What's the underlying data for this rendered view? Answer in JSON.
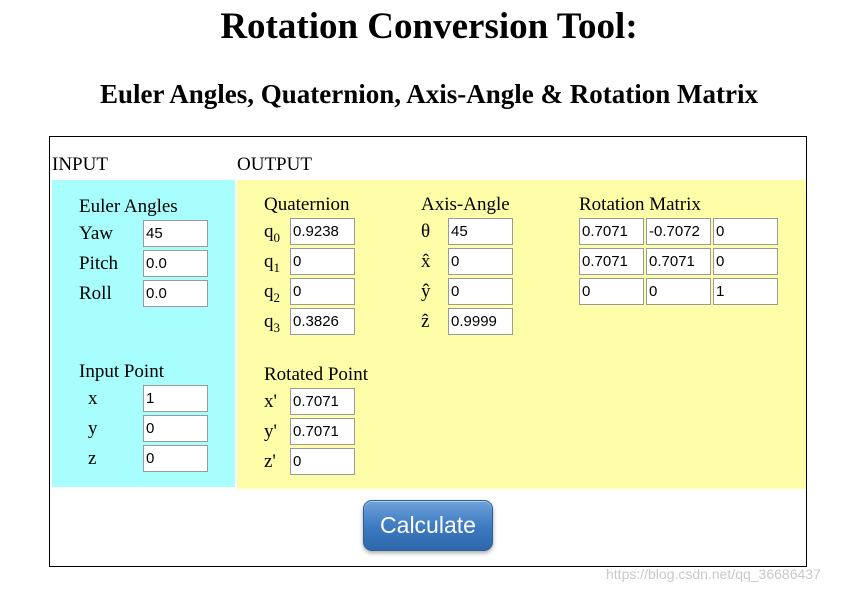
{
  "title": "Rotation Conversion Tool:",
  "subtitle": "Euler Angles, Quaternion, Axis-Angle & Rotation Matrix",
  "input": {
    "heading": "INPUT",
    "euler": {
      "heading": "Euler Angles",
      "yaw_label": "Yaw",
      "yaw": "45",
      "pitch_label": "Pitch",
      "pitch": "0.0",
      "roll_label": "Roll",
      "roll": "0.0"
    },
    "point": {
      "heading": "Input Point",
      "x_label": "x",
      "x": "1",
      "y_label": "y",
      "y": "0",
      "z_label": "z",
      "z": "0"
    }
  },
  "output": {
    "heading": "OUTPUT",
    "quaternion": {
      "heading": "Quaternion",
      "q": [
        {
          "base": "q",
          "sub": "0",
          "value": "0.9238"
        },
        {
          "base": "q",
          "sub": "1",
          "value": "0"
        },
        {
          "base": "q",
          "sub": "2",
          "value": "0"
        },
        {
          "base": "q",
          "sub": "3",
          "value": "0.3826"
        }
      ]
    },
    "axis_angle": {
      "heading": "Axis-Angle",
      "rows": [
        {
          "label": "θ",
          "value": "45"
        },
        {
          "label": "x̂",
          "value": "0"
        },
        {
          "label": "ŷ",
          "value": "0"
        },
        {
          "label": "ẑ",
          "value": "0.9999"
        }
      ]
    },
    "rotation_matrix": {
      "heading": "Rotation Matrix",
      "rows": [
        [
          "0.7071",
          "-0.7072",
          "0"
        ],
        [
          "0.7071",
          "0.7071",
          "0"
        ],
        [
          "0",
          "0",
          "1"
        ]
      ]
    },
    "rotated_point": {
      "heading": "Rotated Point",
      "rows": [
        {
          "label": "x'",
          "value": "0.7071"
        },
        {
          "label": "y'",
          "value": "0.7071"
        },
        {
          "label": "z'",
          "value": "0"
        }
      ]
    }
  },
  "calculate_label": "Calculate",
  "watermark": "https://blog.csdn.net/qq_36686437",
  "colors": {
    "input_panel": "#a8fdfd",
    "output_panel": "#fefda8",
    "button": "#3f7cc2"
  }
}
